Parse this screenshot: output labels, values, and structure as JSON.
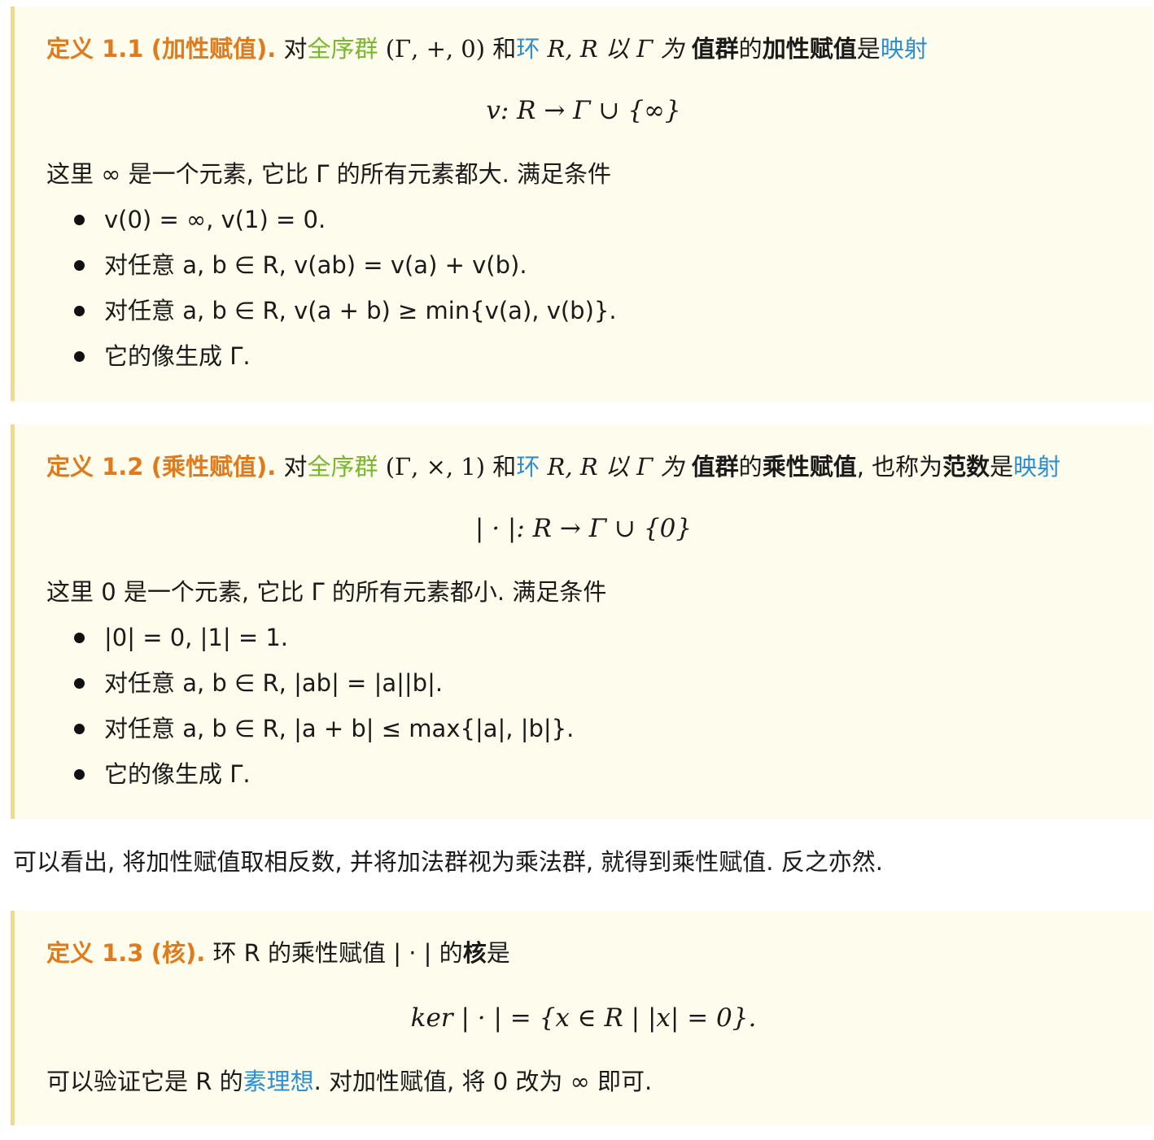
{
  "def1": {
    "label": "定义 1.1",
    "title": "(加性赋值).",
    "intro_a": "对",
    "term_ordered_group": "全序群",
    "group": "(Γ, +, 0)",
    "intro_b": "和",
    "term_ring": "环",
    "intro_c": "R, R 以 Γ 为",
    "bold_value_group": "值群",
    "intro_d": "的",
    "bold_term": "加性赋值",
    "intro_e": "是",
    "term_map": "映射",
    "display": "v: R → Γ ∪ {∞}",
    "remark": "这里 ∞ 是一个元素, 它比 Γ 的所有元素都大. 满足条件",
    "conditions": [
      "v(0) = ∞, v(1) = 0.",
      "对任意 a, b ∈ R, v(ab) = v(a) + v(b).",
      "对任意 a, b ∈ R, v(a + b) ≥ min{v(a), v(b)}.",
      "它的像生成 Γ."
    ]
  },
  "def2": {
    "label": "定义 1.2",
    "title": "(乘性赋值).",
    "intro_a": "对",
    "term_ordered_group": "全序群",
    "group": "(Γ, ×, 1)",
    "intro_b": "和",
    "term_ring": "环",
    "intro_c": "R, R 以 Γ 为",
    "bold_value_group": "值群",
    "intro_d": "的",
    "bold_term": "乘性赋值",
    "intro_e": ", 也称为",
    "bold_norm": "范数",
    "intro_f": "是",
    "term_map": "映射",
    "display": "| · |: R → Γ ∪ {0}",
    "remark": "这里 0 是一个元素, 它比 Γ 的所有元素都小. 满足条件",
    "conditions": [
      "|0| = 0, |1| = 1.",
      "对任意 a, b ∈ R, |ab| = |a||b|.",
      "对任意 a, b ∈ R, |a + b| ≤ max{|a|, |b|}.",
      "它的像生成 Γ."
    ]
  },
  "between_text": "可以看出, 将加性赋值取相反数, 并将加法群视为乘法群, 就得到乘性赋值. 反之亦然.",
  "def3": {
    "label": "定义 1.3",
    "title": "(核).",
    "intro_a": "环 R 的乘性赋值 | · | 的",
    "bold_term": "核",
    "intro_b": "是",
    "display": "ker | · | = {x ∈ R | |x| = 0}.",
    "remark_a": "可以验证它是 R 的",
    "term_prime_ideal": "素理想",
    "remark_b": ". 对加性赋值, 将 0 改为 ∞ 即可."
  },
  "colors": {
    "heading": "#e07a1a",
    "link_green": "#76b82a",
    "link_blue": "#2a8fd6",
    "box_bg": "#fefcec",
    "box_border": "#f4d98a"
  }
}
